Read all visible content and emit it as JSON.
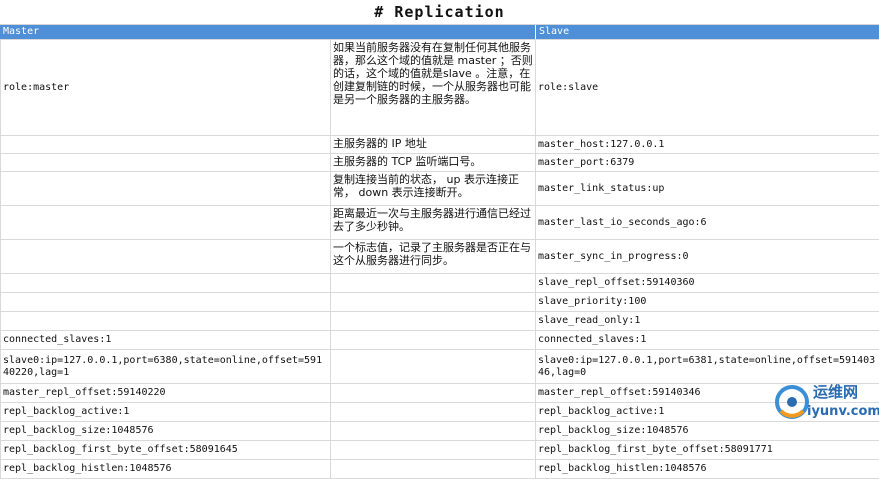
{
  "title": "# Replication",
  "headers": {
    "master": "Master",
    "slave": "Slave"
  },
  "rows": [
    {
      "master": "role:master",
      "note": "如果当前服务器没有在复制任何其他服务器，那么这个域的值就是 master ；否则的话，这个域的值就是slave 。注意，在创建复制链的时候，一个从服务器也可能是另一个服务器的主服务器。",
      "slave": "role:slave"
    },
    {
      "master": "",
      "note": "主服务器的 IP 地址",
      "slave": "master_host:127.0.0.1"
    },
    {
      "master": "",
      "note": "主服务器的 TCP 监听端口号。",
      "slave": "master_port:6379"
    },
    {
      "master": "",
      "note": "复制连接当前的状态， up 表示连接正常， down 表示连接断开。",
      "slave": "master_link_status:up"
    },
    {
      "master": "",
      "note": "距离最近一次与主服务器进行通信已经过去了多少秒钟。",
      "slave": "master_last_io_seconds_ago:6"
    },
    {
      "master": "",
      "note": " 一个标志值，记录了主服务器是否正在与这个从服务器进行同步。",
      "slave": "master_sync_in_progress:0"
    },
    {
      "master": "",
      "note": "",
      "slave": "slave_repl_offset:59140360"
    },
    {
      "master": "",
      "note": "",
      "slave": "slave_priority:100"
    },
    {
      "master": "",
      "note": "",
      "slave": "slave_read_only:1"
    },
    {
      "master": "connected_slaves:1",
      "note": "",
      "slave": "connected_slaves:1"
    },
    {
      "master": "slave0:ip=127.0.0.1,port=6380,state=online,offset=59140220,lag=1",
      "note": "",
      "slave": "slave0:ip=127.0.0.1,port=6381,state=online,offset=59140346,lag=0"
    },
    {
      "master": "master_repl_offset:59140220",
      "note": "",
      "slave": "master_repl_offset:59140346"
    },
    {
      "master": "repl_backlog_active:1",
      "note": "",
      "slave": "repl_backlog_active:1"
    },
    {
      "master": "repl_backlog_size:1048576",
      "note": "",
      "slave": "repl_backlog_size:1048576"
    },
    {
      "master": "repl_backlog_first_byte_offset:58091645",
      "note": "",
      "slave": "repl_backlog_first_byte_offset:58091771"
    },
    {
      "master": "repl_backlog_histlen:1048576",
      "note": "",
      "slave": "repl_backlog_histlen:1048576"
    }
  ],
  "watermark": {
    "line1": "运维网",
    "line2": "iyunv.com"
  },
  "colors": {
    "header_bg": "#4f8fd8",
    "grid": "#d9d9d9"
  }
}
